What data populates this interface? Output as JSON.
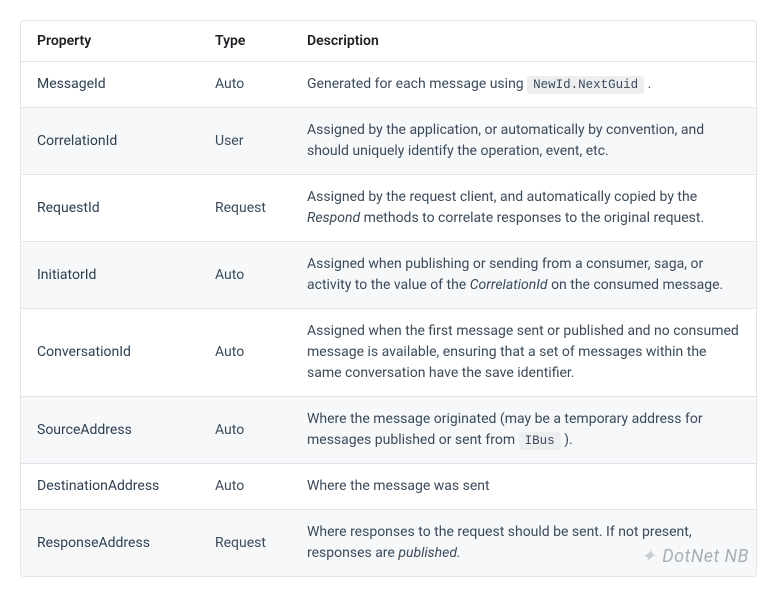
{
  "table": {
    "headers": {
      "property": "Property",
      "type": "Type",
      "description": "Description"
    },
    "rows": [
      {
        "property": "MessageId",
        "type": "Auto",
        "desc_pre": "Generated for each message using ",
        "desc_code": "NewId.NextGuid",
        "desc_post": " ."
      },
      {
        "property": "CorrelationId",
        "type": "User",
        "desc_pre": "Assigned by the application, or automatically by convention, and should uniquely identify the operation, event, etc."
      },
      {
        "property": "RequestId",
        "type": "Request",
        "desc_pre": "Assigned by the request client, and automatically copied by the ",
        "desc_em": "Respond",
        "desc_post": " methods to correlate responses to the original request."
      },
      {
        "property": "InitiatorId",
        "type": "Auto",
        "desc_pre": "Assigned when publishing or sending from a consumer, saga, or activity to the value of the ",
        "desc_em": "CorrelationId",
        "desc_post": " on the consumed message."
      },
      {
        "property": "ConversationId",
        "type": "Auto",
        "desc_pre": "Assigned when the first message sent or published and no consumed message is available, ensuring that a set of messages within the same conversation have the save identifier."
      },
      {
        "property": "SourceAddress",
        "type": "Auto",
        "desc_pre": "Where the message originated (may be a temporary address for messages published or sent from ",
        "desc_code": "IBus",
        "desc_post": " )."
      },
      {
        "property": "DestinationAddress",
        "type": "Auto",
        "desc_pre": "Where the message was sent"
      },
      {
        "property": "ResponseAddress",
        "type": "Request",
        "desc_pre": "Where responses to the request should be sent. If not present, responses are ",
        "desc_em": "published.",
        "desc_post": ""
      }
    ]
  },
  "watermark": {
    "text": "DotNet NB"
  }
}
